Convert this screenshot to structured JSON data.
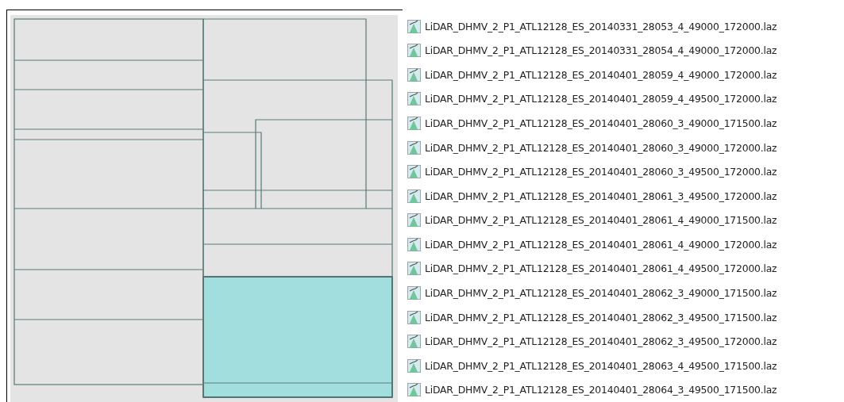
{
  "files": [
    {
      "name": "LiDAR_DHMV_2_P1_ATL12128_ES_20140331_28053_4_49000_172000.laz"
    },
    {
      "name": "LiDAR_DHMV_2_P1_ATL12128_ES_20140331_28054_4_49000_172000.laz"
    },
    {
      "name": "LiDAR_DHMV_2_P1_ATL12128_ES_20140401_28059_4_49000_172000.laz"
    },
    {
      "name": "LiDAR_DHMV_2_P1_ATL12128_ES_20140401_28059_4_49500_172000.laz"
    },
    {
      "name": "LiDAR_DHMV_2_P1_ATL12128_ES_20140401_28060_3_49000_171500.laz"
    },
    {
      "name": "LiDAR_DHMV_2_P1_ATL12128_ES_20140401_28060_3_49000_172000.laz"
    },
    {
      "name": "LiDAR_DHMV_2_P1_ATL12128_ES_20140401_28060_3_49500_172000.laz"
    },
    {
      "name": "LiDAR_DHMV_2_P1_ATL12128_ES_20140401_28061_3_49500_172000.laz"
    },
    {
      "name": "LiDAR_DHMV_2_P1_ATL12128_ES_20140401_28061_4_49000_171500.laz"
    },
    {
      "name": "LiDAR_DHMV_2_P1_ATL12128_ES_20140401_28061_4_49000_172000.laz"
    },
    {
      "name": "LiDAR_DHMV_2_P1_ATL12128_ES_20140401_28061_4_49500_172000.laz"
    },
    {
      "name": "LiDAR_DHMV_2_P1_ATL12128_ES_20140401_28062_3_49000_171500.laz"
    },
    {
      "name": "LiDAR_DHMV_2_P1_ATL12128_ES_20140401_28062_3_49500_171500.laz"
    },
    {
      "name": "LiDAR_DHMV_2_P1_ATL12128_ES_20140401_28062_3_49500_172000.laz"
    },
    {
      "name": "LiDAR_DHMV_2_P1_ATL12128_ES_20140401_28063_4_49500_171500.laz"
    },
    {
      "name": "LiDAR_DHMV_2_P1_ATL12128_ES_20140401_28064_3_49500_171500.laz"
    }
  ]
}
